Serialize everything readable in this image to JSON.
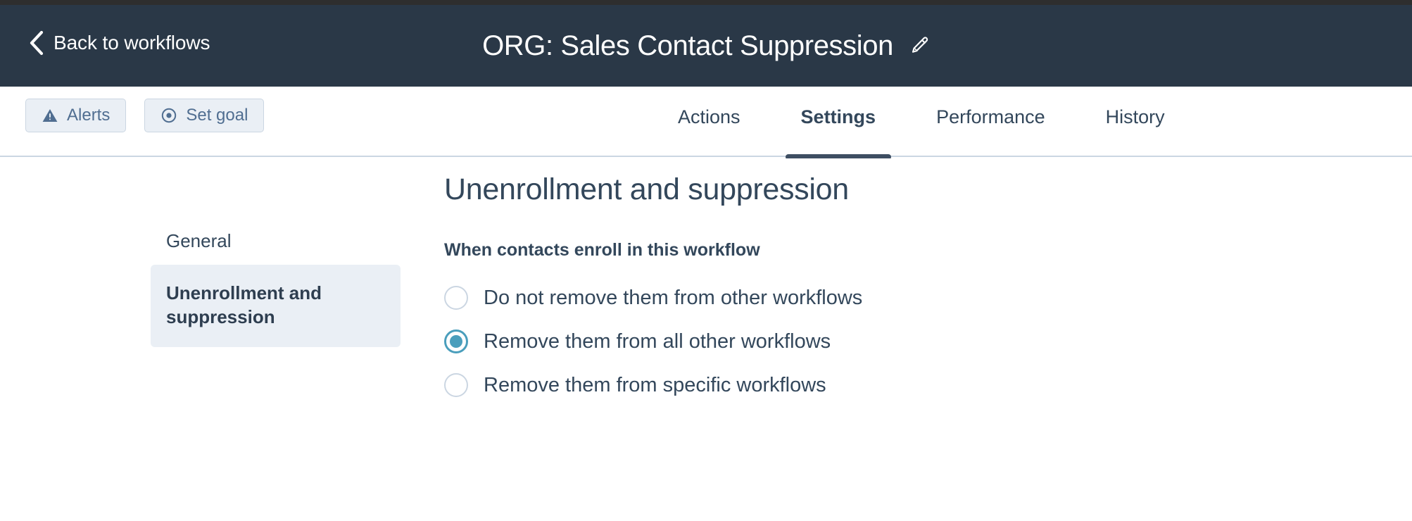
{
  "header": {
    "back_label": "Back to workflows",
    "back_icon": "chevron-left-icon",
    "title": "ORG: Sales Contact Suppression",
    "edit_icon": "pencil-icon",
    "background_color": "#2a3847"
  },
  "subnav": {
    "buttons": [
      {
        "label": "Alerts",
        "icon": "warning-triangle-icon"
      },
      {
        "label": "Set goal",
        "icon": "target-icon"
      }
    ],
    "tabs": [
      {
        "label": "Actions",
        "active": false
      },
      {
        "label": "Settings",
        "active": true
      },
      {
        "label": "Performance",
        "active": false
      },
      {
        "label": "History",
        "active": false
      }
    ],
    "active_tab_indicator_color": "#3e4e62"
  },
  "settings_nav": {
    "items": [
      {
        "label": "General",
        "selected": false
      },
      {
        "label": "Unenrollment and suppression",
        "selected": true
      }
    ],
    "selected_background": "#eaeff5"
  },
  "panel": {
    "title": "Unenrollment and suppression",
    "subtitle": "When contacts enroll in this workflow",
    "options": [
      {
        "label": "Do not remove them from other workflows",
        "checked": false
      },
      {
        "label": "Remove them from all other workflows",
        "checked": true
      },
      {
        "label": "Remove them from specific workflows",
        "checked": false
      }
    ],
    "accent_color": "#4a9ebc"
  }
}
